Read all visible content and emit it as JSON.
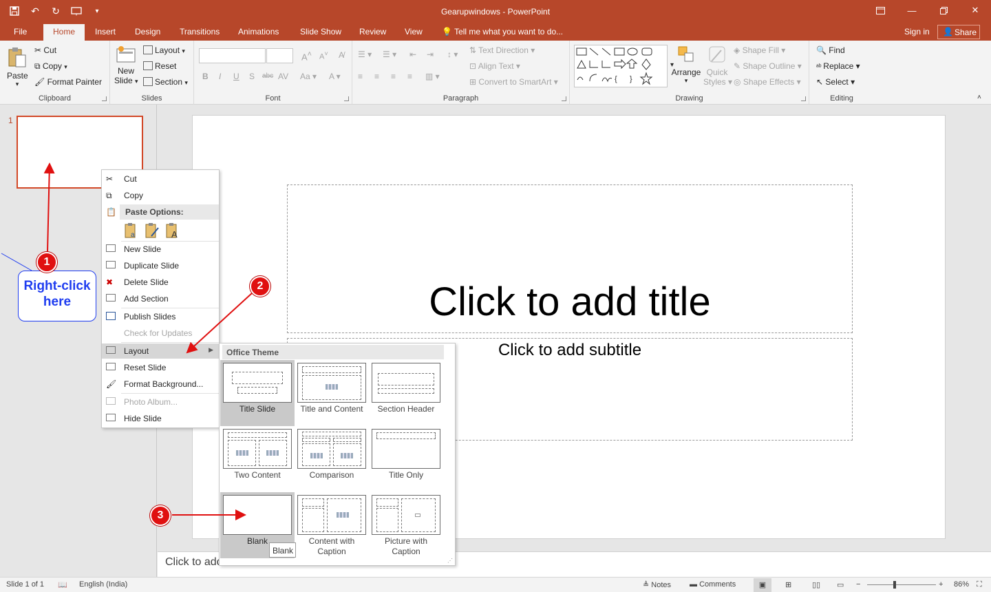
{
  "app": {
    "window_title": "Gearupwindows - PowerPoint",
    "tabs": [
      "File",
      "Home",
      "Insert",
      "Design",
      "Transitions",
      "Animations",
      "Slide Show",
      "Review",
      "View"
    ],
    "active_tab": "Home",
    "tell_me": "Tell me what you want to do...",
    "sign_in": "Sign in",
    "share": "Share"
  },
  "ribbon": {
    "clipboard": {
      "label": "Clipboard",
      "paste": "Paste",
      "cut": "Cut",
      "copy": "Copy",
      "format_painter": "Format Painter"
    },
    "slides": {
      "label": "Slides",
      "new_slide_1": "New",
      "new_slide_2": "Slide",
      "layout": "Layout",
      "reset": "Reset",
      "section": "Section"
    },
    "font": {
      "label": "Font"
    },
    "paragraph": {
      "label": "Paragraph",
      "text_direction": "Text Direction",
      "align_text": "Align Text",
      "convert_smartart": "Convert to SmartArt"
    },
    "drawing": {
      "label": "Drawing",
      "arrange": "Arrange",
      "quick_styles_1": "Quick",
      "quick_styles_2": "Styles",
      "shape_fill": "Shape Fill",
      "shape_outline": "Shape Outline",
      "shape_effects": "Shape Effects"
    },
    "editing": {
      "label": "Editing",
      "find": "Find",
      "replace": "Replace",
      "select": "Select"
    }
  },
  "thumbnails": {
    "slide_number": "1"
  },
  "slide": {
    "title_placeholder": "Click to add title",
    "subtitle_placeholder": "Click to add subtitle"
  },
  "notes": {
    "placeholder": "Click to add"
  },
  "context_menu": {
    "cut": "Cut",
    "copy": "Copy",
    "paste_options": "Paste Options:",
    "new_slide": "New Slide",
    "duplicate_slide": "Duplicate Slide",
    "delete_slide": "Delete Slide",
    "add_section": "Add Section",
    "publish_slides": "Publish Slides",
    "check_updates": "Check for Updates",
    "layout": "Layout",
    "reset_slide": "Reset Slide",
    "format_background": "Format Background...",
    "photo_album": "Photo Album...",
    "hide_slide": "Hide Slide"
  },
  "layout_menu": {
    "header": "Office Theme",
    "items": [
      {
        "name": "Title Slide"
      },
      {
        "name": "Title and Content"
      },
      {
        "name": "Section Header"
      },
      {
        "name": "Two Content"
      },
      {
        "name": "Comparison"
      },
      {
        "name": "Title Only"
      },
      {
        "name": "Blank"
      },
      {
        "name_line1": "Content with",
        "name_line2": "Caption"
      },
      {
        "name_line1": "Picture with",
        "name_line2": "Caption"
      }
    ],
    "tooltip": "Blank"
  },
  "annotations": {
    "callout_line1": "Right-click",
    "callout_line2": "here",
    "step1": "1",
    "step2": "2",
    "step3": "3",
    "callout_color": "#1f3df0",
    "arrow_color": "#e01010"
  },
  "status": {
    "slide_of": "Slide 1 of 1",
    "language": "English (India)",
    "notes": "Notes",
    "comments": "Comments",
    "zoom": "86%"
  },
  "colors": {
    "accent": "#b7472a",
    "selection_border": "#d24726"
  }
}
